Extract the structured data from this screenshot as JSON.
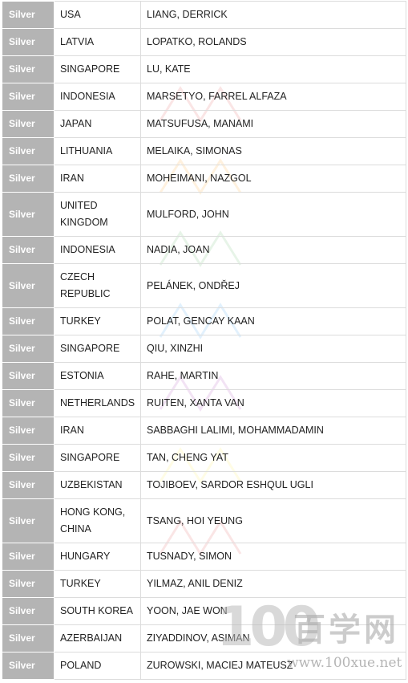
{
  "table": {
    "rows": [
      {
        "medal": "Silver",
        "country": "USA",
        "name": "LIANG, DERRICK"
      },
      {
        "medal": "Silver",
        "country": "LATVIA",
        "name": "LOPATKO, ROLANDS"
      },
      {
        "medal": "Silver",
        "country": "SINGAPORE",
        "name": "LU, KATE"
      },
      {
        "medal": "Silver",
        "country": "INDONESIA",
        "name": "MARSETYO, FARREL ALFAZA"
      },
      {
        "medal": "Silver",
        "country": "JAPAN",
        "name": "MATSUFUSA, MANAMI"
      },
      {
        "medal": "Silver",
        "country": "LITHUANIA",
        "name": "MELAIKA, SIMONAS"
      },
      {
        "medal": "Silver",
        "country": "IRAN",
        "name": "MOHEIMANI, NAZGOL"
      },
      {
        "medal": "Silver",
        "country": "UNITED KINGDOM",
        "name": "MULFORD, JOHN"
      },
      {
        "medal": "Silver",
        "country": "INDONESIA",
        "name": "NADIA, JOAN"
      },
      {
        "medal": "Silver",
        "country": "CZECH REPUBLIC",
        "name": "PELÁNEK, ONDŘEJ"
      },
      {
        "medal": "Silver",
        "country": "TURKEY",
        "name": "POLAT, GENCAY KAAN"
      },
      {
        "medal": "Silver",
        "country": "SINGAPORE",
        "name": "QIU, XINZHI"
      },
      {
        "medal": "Silver",
        "country": "ESTONIA",
        "name": "RAHE, MARTIN"
      },
      {
        "medal": "Silver",
        "country": "NETHERLANDS",
        "name": "RUITEN, XANTA VAN"
      },
      {
        "medal": "Silver",
        "country": "IRAN",
        "name": "SABBAGHI LALIMI, MOHAMMADAMIN"
      },
      {
        "medal": "Silver",
        "country": "SINGAPORE",
        "name": "TAN, CHENG YAT"
      },
      {
        "medal": "Silver",
        "country": "UZBEKISTAN",
        "name": "TOJIBOEV, SARDOR ESHQUL UGLI"
      },
      {
        "medal": "Silver",
        "country": "HONG KONG, CHINA",
        "name": "TSANG, HOI YEUNG"
      },
      {
        "medal": "Silver",
        "country": "HUNGARY",
        "name": "TUSNADY, SIMON"
      },
      {
        "medal": "Silver",
        "country": "TURKEY",
        "name": "YILMAZ, ANIL DENIZ"
      },
      {
        "medal": "Silver",
        "country": "SOUTH KOREA",
        "name": "YOON, JAE WON"
      },
      {
        "medal": "Silver",
        "country": "AZERBAIJAN",
        "name": "ZIYADDINOV, ASIMAN"
      },
      {
        "medal": "Silver",
        "country": "POLAND",
        "name": "ZUROWSKI, MACIEJ MATEUSZ"
      }
    ]
  },
  "watermark": {
    "number": "100",
    "site_name": "百学网",
    "url": "www.100xue.net"
  },
  "colors": {
    "medal_bg": "#b4b4b4",
    "medal_text": "#ffffff",
    "border": "#dcdcdc",
    "text": "#222222"
  }
}
